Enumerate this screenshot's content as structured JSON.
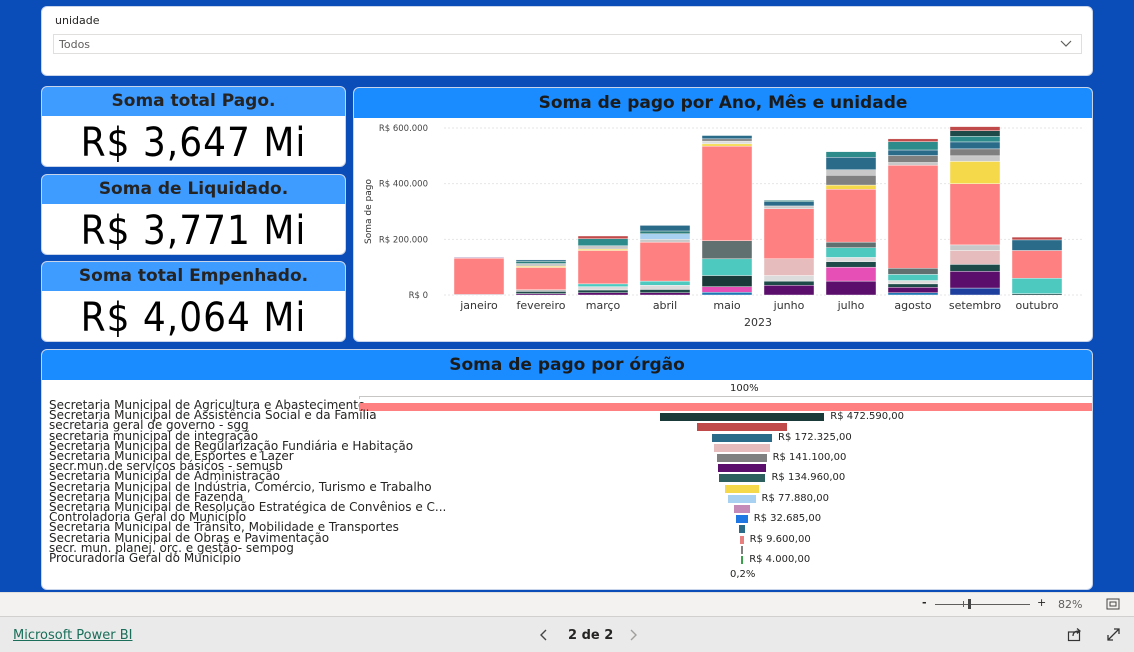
{
  "slicer": {
    "title": "unidade",
    "value": "Todos"
  },
  "kpis": [
    {
      "title": "Soma total Pago.",
      "value": "R$ 3,647 Mi"
    },
    {
      "title": "Soma de Liquidado.",
      "value": "R$ 3,771 Mi"
    },
    {
      "title": "Soma total Empenhado.",
      "value": "R$ 4,064 Mi"
    }
  ],
  "chart_data": [
    {
      "type": "bar",
      "title": "Soma de pago por Ano, Mês e unidade",
      "xlabel": "2023",
      "ylabel": "Soma de pago",
      "ylim": [
        0,
        600000
      ],
      "ytick_labels": [
        "R$ 0",
        "R$ 200.000",
        "R$ 400.000",
        "R$ 600.000"
      ],
      "categories": [
        "janeiro",
        "fevereiro",
        "março",
        "abril",
        "maio",
        "junho",
        "julho",
        "agosto",
        "setembro",
        "outubro"
      ],
      "stacked": true,
      "stack_segments": [
        [
          [
            2000,
            "#1f77b4"
          ],
          [
            130000,
            "#ff8080"
          ],
          [
            3000,
            "#a07cb0"
          ]
        ],
        [
          [
            5000,
            "#5b0e6b"
          ],
          [
            8000,
            "#1f4a4a"
          ],
          [
            6000,
            "#c0c0c0"
          ],
          [
            80000,
            "#ff8080"
          ],
          [
            4000,
            "#f5d94a"
          ],
          [
            10000,
            "#c8c8c8"
          ],
          [
            8000,
            "#2e7d7d"
          ],
          [
            5000,
            "#2b6b8a"
          ]
        ],
        [
          [
            8000,
            "#5b0e6b"
          ],
          [
            10000,
            "#1f4a4a"
          ],
          [
            12000,
            "#dcdcdc"
          ],
          [
            10000,
            "#4ec9c0"
          ],
          [
            120000,
            "#ff8080"
          ],
          [
            5000,
            "#f5d94a"
          ],
          [
            12000,
            "#c8c8c8"
          ],
          [
            25000,
            "#2e8b8b"
          ],
          [
            10000,
            "#c04a4a"
          ]
        ],
        [
          [
            8000,
            "#5b0e6b"
          ],
          [
            12000,
            "#1f4a4a"
          ],
          [
            15000,
            "#dcdcdc"
          ],
          [
            15000,
            "#4ec9c0"
          ],
          [
            140000,
            "#ff8080"
          ],
          [
            10000,
            "#c8c8c8"
          ],
          [
            20000,
            "#a8d0f0"
          ],
          [
            10000,
            "#2e7d7d"
          ],
          [
            20000,
            "#2b6b8a"
          ]
        ],
        [
          [
            10000,
            "#1f77b4"
          ],
          [
            20000,
            "#e64fb5"
          ],
          [
            40000,
            "#1a3a3a"
          ],
          [
            60000,
            "#4ec9c0"
          ],
          [
            65000,
            "#607070"
          ],
          [
            340000,
            "#ff8080"
          ],
          [
            8000,
            "#f5d94a"
          ],
          [
            10000,
            "#dcdcdc"
          ],
          [
            8000,
            "#808080"
          ],
          [
            12000,
            "#2b6b8a"
          ]
        ],
        [
          [
            35000,
            "#5b0e6b"
          ],
          [
            15000,
            "#1f4a4a"
          ],
          [
            20000,
            "#dcdcdc"
          ],
          [
            60000,
            "#e6bcbc"
          ],
          [
            180000,
            "#ff8080"
          ],
          [
            10000,
            "#c8c8c8"
          ],
          [
            15000,
            "#2b6b8a"
          ],
          [
            5000,
            "#2e7d7d"
          ]
        ],
        [
          [
            50000,
            "#5b0e6b"
          ],
          [
            50000,
            "#e64fb5"
          ],
          [
            20000,
            "#1f4a4a"
          ],
          [
            15000,
            "#dcdcdc"
          ],
          [
            35000,
            "#4ec9c0"
          ],
          [
            20000,
            "#607070"
          ],
          [
            190000,
            "#ff8080"
          ],
          [
            15000,
            "#f5d94a"
          ],
          [
            35000,
            "#808080"
          ],
          [
            20000,
            "#c8c8c8"
          ],
          [
            45000,
            "#2b6b8a"
          ],
          [
            20000,
            "#2e8b8b"
          ]
        ],
        [
          [
            8000,
            "#1f77b4"
          ],
          [
            20000,
            "#5b0e6b"
          ],
          [
            12000,
            "#1f4a4a"
          ],
          [
            12000,
            "#dcdcdc"
          ],
          [
            22000,
            "#4ec9c0"
          ],
          [
            22000,
            "#607070"
          ],
          [
            370000,
            "#ff8080"
          ],
          [
            10000,
            "#c8c8c8"
          ],
          [
            25000,
            "#808080"
          ],
          [
            20000,
            "#2b6b8a"
          ],
          [
            30000,
            "#2e8b8b"
          ],
          [
            10000,
            "#c04a4a"
          ]
        ],
        [
          [
            25000,
            "#1f3f9f"
          ],
          [
            60000,
            "#5b0e6b"
          ],
          [
            25000,
            "#1f4a4a"
          ],
          [
            50000,
            "#e6bcbc"
          ],
          [
            20000,
            "#c8c8c8"
          ],
          [
            220000,
            "#ff8080"
          ],
          [
            80000,
            "#f5d94a"
          ],
          [
            20000,
            "#c8c8c8"
          ],
          [
            25000,
            "#808080"
          ],
          [
            25000,
            "#2b6b8a"
          ],
          [
            20000,
            "#2e8b8b"
          ],
          [
            20000,
            "#1f4a4a"
          ],
          [
            15000,
            "#c04a4a"
          ]
        ],
        [
          [
            5000,
            "#1f4a4a"
          ],
          [
            55000,
            "#4ec9c0"
          ],
          [
            100000,
            "#ff8080"
          ],
          [
            38000,
            "#2b6b8a"
          ],
          [
            10000,
            "#c04a4a"
          ]
        ]
      ]
    },
    {
      "type": "funnel",
      "title": "Soma de pago por órgão",
      "top_percent": "100%",
      "bottom_percent": "0,2%",
      "rows": [
        {
          "label": "Secretaria Municipal de Agricultura e Abastecimento",
          "value": 2200000,
          "color": "#ff8080",
          "value_label": ""
        },
        {
          "label": "Secretaria Municipal de Assistência Social e da Família",
          "value": 472590,
          "color": "#1a3a3a",
          "value_label": "R$ 472.590,00"
        },
        {
          "label": "secretaria geral de governo - sgg",
          "value": 260000,
          "color": "#c04a4a",
          "value_label": ""
        },
        {
          "label": "secretaria municipal de integração",
          "value": 172325,
          "color": "#2b6b8a",
          "value_label": "R$ 172.325,00"
        },
        {
          "label": "Secretaria Municipal de Regularização Fundiária e Habitação",
          "value": 160000,
          "color": "#e6bcbc",
          "value_label": ""
        },
        {
          "label": "Secretaria Municipal de Esportes e Lazer",
          "value": 141100,
          "color": "#808080",
          "value_label": "R$ 141.100,00"
        },
        {
          "label": "secr.mun.de serviços básicos - semusb",
          "value": 138000,
          "color": "#5b0e6b",
          "value_label": ""
        },
        {
          "label": "Secretaria Municipal de Administração",
          "value": 134960,
          "color": "#2e5f5f",
          "value_label": "R$ 134.960,00"
        },
        {
          "label": "Secretaria Municipal de Indústria, Comércio, Turismo e Trabalho",
          "value": 100000,
          "color": "#f5d94a",
          "value_label": ""
        },
        {
          "label": "Secretaria Municipal de Fazenda",
          "value": 77880,
          "color": "#a8d0f0",
          "value_label": "R$ 77.880,00"
        },
        {
          "label": "Secretaria Municipal de Resolução Estratégica de Convênios e C...",
          "value": 45000,
          "color": "#c48bb8",
          "value_label": ""
        },
        {
          "label": "Controladoria Geral do Município",
          "value": 32685,
          "color": "#1f77e4",
          "value_label": "R$ 32.685,00"
        },
        {
          "label": "Secretaria Municipal de Trânsito, Mobilidade e Transportes",
          "value": 20000,
          "color": "#2b6b8a",
          "value_label": ""
        },
        {
          "label": "Secretaria Municipal de Obras e Pavimentação",
          "value": 9600,
          "color": "#e88080",
          "value_label": "R$ 9.600,00"
        },
        {
          "label": "secr. mun. planej. orç. e gestão- sempog",
          "value": 7000,
          "color": "#808080",
          "value_label": ""
        },
        {
          "label": "Procuradoria Geral do Município",
          "value": 4000,
          "color": "#3aa04a",
          "value_label": "R$ 4.000,00"
        }
      ]
    }
  ],
  "statusbar": {
    "zoom": "82%",
    "minus": "-",
    "plus": "+"
  },
  "footer": {
    "brand": "Microsoft Power BI",
    "page": "2 de 2"
  }
}
